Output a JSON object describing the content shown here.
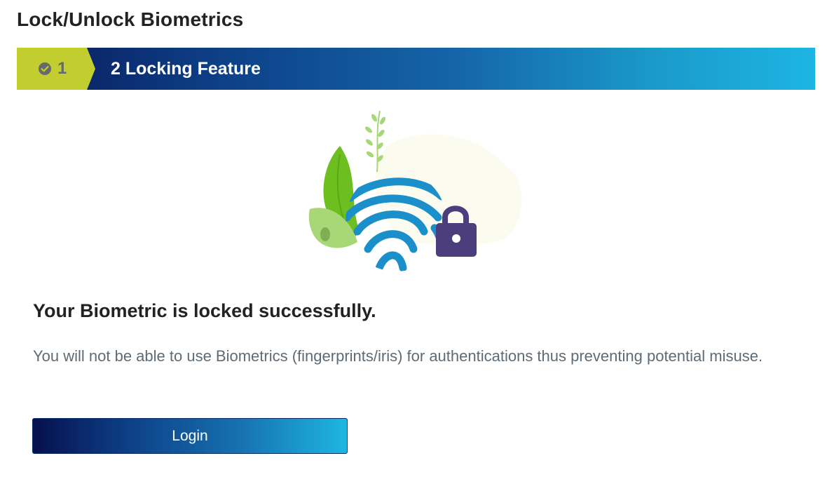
{
  "page": {
    "title": "Lock/Unlock Biometrics"
  },
  "stepper": {
    "steps": [
      {
        "number": "1",
        "label": "",
        "status": "completed",
        "icon": "check-circle-icon",
        "color": "#c2cd30"
      },
      {
        "number": "2",
        "label": "2 Locking Feature",
        "status": "active"
      }
    ]
  },
  "illustration": {
    "icon": "fingerprint-lock-illustration",
    "colors": {
      "fingerprint": "#1a8fc9",
      "lock": "#4a3f7c",
      "leaf": "#6cbf1e"
    }
  },
  "result": {
    "heading": "Your Biometric is locked successfully.",
    "description": "You will not be able to use Biometrics (fingerprints/iris) for authentications thus preventing potential misuse."
  },
  "actions": {
    "login_label": "Login"
  },
  "colors": {
    "accent_start": "#0a1a5c",
    "accent_end": "#1db5e2",
    "step_done": "#c2cd30"
  }
}
